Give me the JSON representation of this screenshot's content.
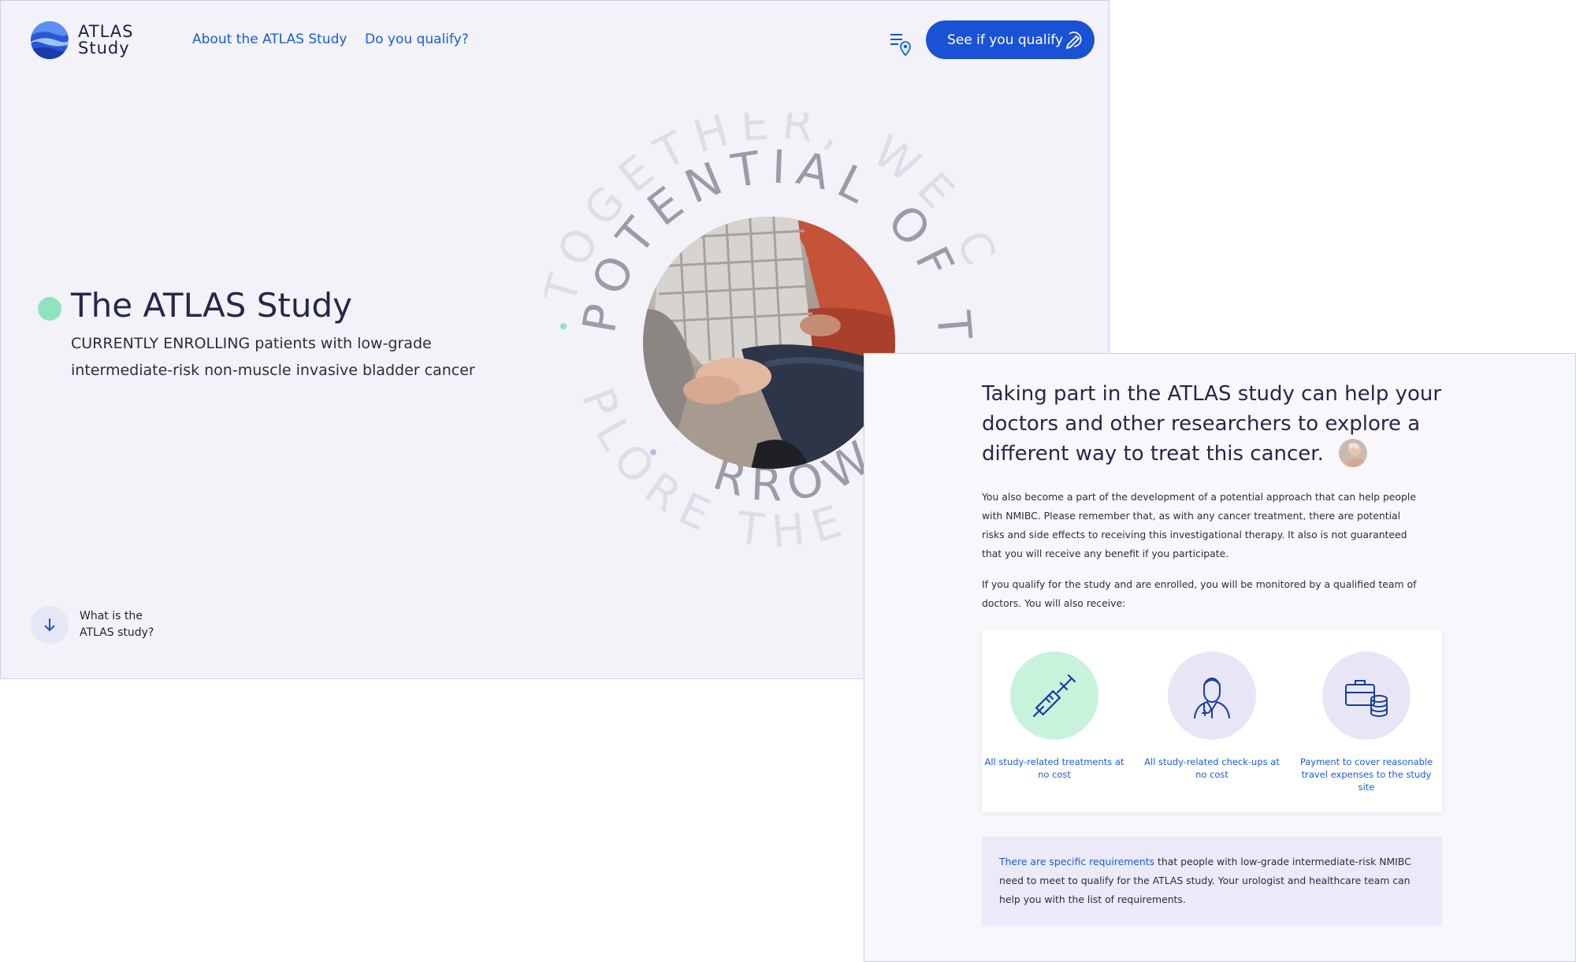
{
  "site": {
    "logo_line1": "ATLAS",
    "logo_line2": "Study"
  },
  "nav": {
    "about_label": "About the ATLAS Study",
    "qualify_label": "Do you qualify?",
    "cta_label": "See if you qualify"
  },
  "hero": {
    "title": "The ATLAS Study",
    "subtitle_line1": "CURRENTLY ENROLLING patients with low-grade",
    "subtitle_line2": "intermediate-risk non-muscle invasive bladder cancer",
    "outer_ring_text": "TOGETHER, WE C",
    "inner_ring_text": "POTENTIAL OF TO",
    "bottom_outer_text": "PLORE THE",
    "bottom_inner_text": "RROW"
  },
  "scroll_cue": {
    "line1": "What is the",
    "line2": "ATLAS study?"
  },
  "info": {
    "heading": "Taking part in the ATLAS study can help your doctors and other researchers to explore a different way to treat this cancer.",
    "para1": "You also become a part of the development of a potential approach that can help people with NMIBC. Please remember that, as with any cancer treatment, there are potential risks and side effects to receiving this investigational therapy. It also is not guaranteed that you will receive any benefit if you participate.",
    "para2": "If you qualify for the study and are enrolled, you will be monitored by a qualified team of doctors. You will also receive:",
    "benefits": [
      {
        "label": "All study-related treatments at no cost",
        "icon": "syringe-icon",
        "color": "#c9f2dc"
      },
      {
        "label": "All study-related check-ups at no cost",
        "icon": "doctor-icon",
        "color": "#e8e6f6"
      },
      {
        "label": "Payment to cover reasonable travel expenses to the study site",
        "icon": "briefcase-coins-icon",
        "color": "#e8e6f6"
      }
    ],
    "req_link": "There are specific requirements",
    "req_text": " that people with low-grade intermediate-risk NMIBC need to meet to qualify for the ATLAS study. Your urologist and healthcare team can help you with the list of requirements."
  },
  "colors": {
    "accent": "#1a52d6",
    "link": "#1a5cd6",
    "mint": "#8fe3bf",
    "page_bg": "#f2f2f8"
  }
}
